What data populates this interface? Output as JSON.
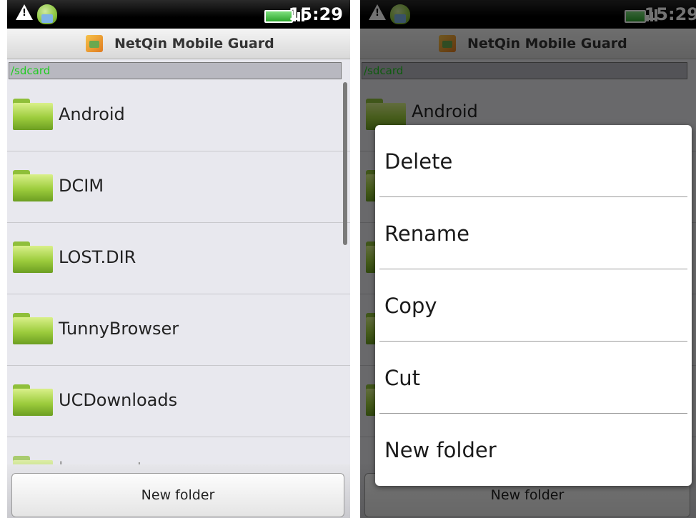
{
  "status_bar": {
    "time": "15:29",
    "icons": [
      "warning-icon",
      "android-icon",
      "no-sync-icon",
      "signal-icon",
      "battery-icon"
    ]
  },
  "app": {
    "title": "NetQin Mobile Guard"
  },
  "path": "/sdcard",
  "folders": [
    "Android",
    "DCIM",
    "LOST.DIR",
    "TunnyBrowser",
    "UCDownloads",
    "bugreports"
  ],
  "bottom": {
    "new_folder_label": "New folder"
  },
  "context_menu": {
    "items": [
      "Delete",
      "Rename",
      "Copy",
      "Cut",
      "New folder"
    ]
  },
  "colors": {
    "path_text": "#22cc22",
    "folder": "#9ccc3c"
  }
}
